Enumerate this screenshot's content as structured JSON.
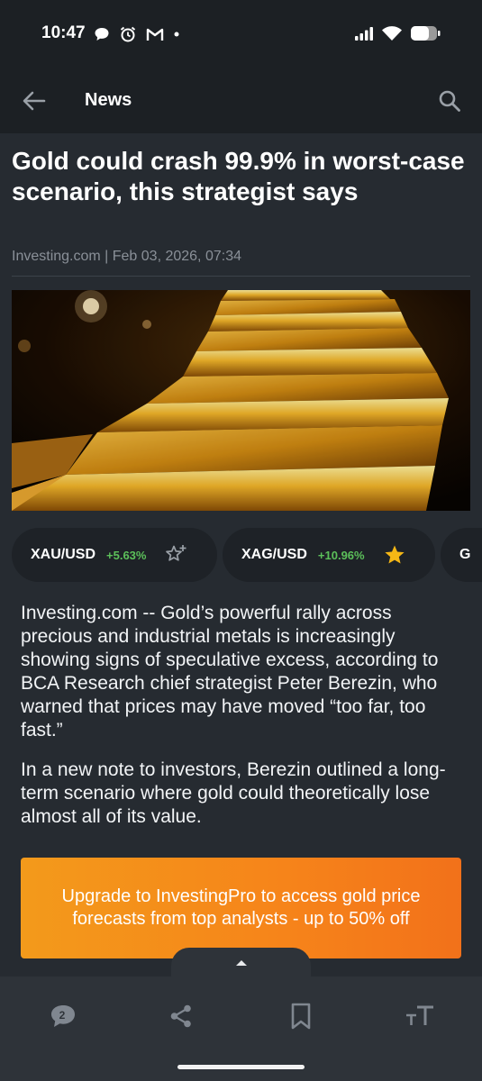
{
  "status_bar": {
    "time": "10:47"
  },
  "app_bar": {
    "title": "News"
  },
  "article": {
    "headline": "Gold could crash 99.9% in worst-case scenario, this strategist says",
    "meta": "Investing.com | Feb 03, 2026, 07:34",
    "paragraphs": [
      "Investing.com -- Gold’s powerful rally across precious and industrial metals is increasingly showing signs of speculative excess, according to BCA Research chief strategist Peter Berezin, who warned that prices may have moved “too far, too fast.”",
      "In a new note to investors, Berezin outlined a long-term scenario where gold could theoretically lose almost all of its value."
    ]
  },
  "instruments": [
    {
      "symbol": "XAU/USD",
      "change": "+5.63%",
      "watchlisted": false
    },
    {
      "symbol": "XAG/USD",
      "change": "+10.96%",
      "watchlisted": true
    },
    {
      "symbol": "G",
      "change": "",
      "watchlisted": false
    }
  ],
  "promo": {
    "label": "Upgrade to InvestingPro to access gold price forecasts from top analysts - up to 50% off"
  },
  "bottom_bar": {
    "comment_count": "2"
  },
  "colors": {
    "positive": "#5cc05a",
    "star_active": "#f5b715",
    "promo_orange": "#f6841a",
    "background": "#262b31"
  }
}
